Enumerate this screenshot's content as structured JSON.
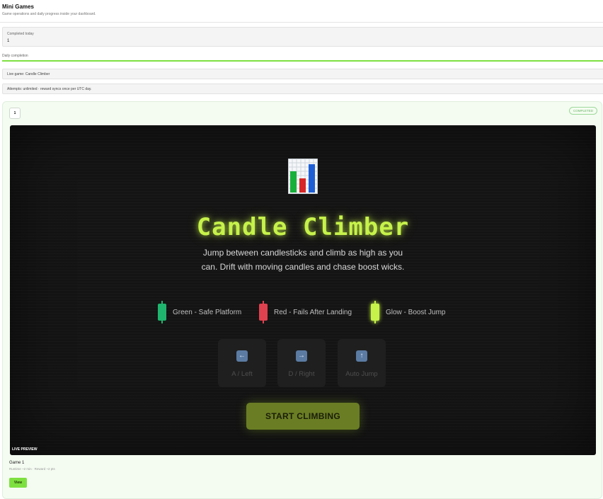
{
  "header": {
    "title": "Mini Games",
    "subtitle": "Game operations and daily progress inside your dashboard."
  },
  "stats": {
    "completed_label": "Completed today",
    "completed_value": "1"
  },
  "progress": {
    "label": "Daily completion",
    "fraction": 1.0,
    "fill_color": "#7ee040"
  },
  "info": {
    "live_game": "Live game: Candle Climber",
    "attempts": "Attempts: unlimited · reward syncs once per UTC day."
  },
  "card": {
    "number": "1",
    "status": "COMPLETED",
    "preview": {
      "icon": "bar-chart-icon",
      "title": "Candle Climber",
      "description": "Jump between candlesticks and climb as high as you can. Drift with moving candles and chase boost wicks.",
      "legend": [
        {
          "label": "Green - Safe Platform",
          "color": "#1fb56e"
        },
        {
          "label": "Red - Fails After Landing",
          "color": "#e0414e"
        },
        {
          "label": "Glow - Boost Jump",
          "color": "#c6f24a"
        }
      ],
      "controls": [
        {
          "icon": "arrow-left-icon",
          "label": "A / Left"
        },
        {
          "icon": "arrow-right-icon",
          "label": "D / Right"
        },
        {
          "icon": "arrow-up-icon",
          "label": "Auto Jump"
        }
      ],
      "start_label": "START CLIMBING",
      "live_tag": "LIVE PREVIEW"
    },
    "game_name": "Game 1",
    "game_meta": "Runtime ~2 min · Reward ~2 pts",
    "view_label": "View"
  }
}
